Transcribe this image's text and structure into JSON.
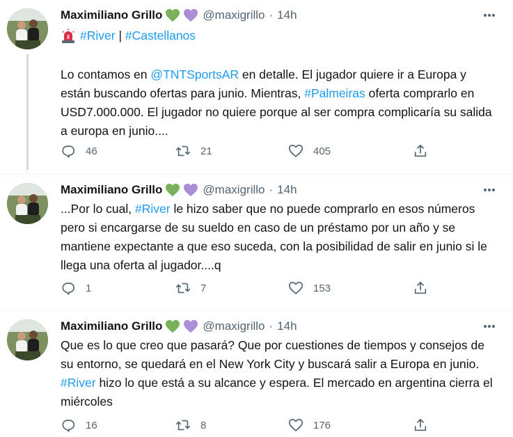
{
  "tweets": [
    {
      "name": "Maximiliano Grillo",
      "handle": "@maxigrillo",
      "time": "14h",
      "tags_prefix": "",
      "tag_river": "#River",
      "tag_sep": " | ",
      "tag_castellanos": "#Castellanos",
      "text_a": "Lo contamos en ",
      "mention": "@TNTSportsAR",
      "text_b": " en detalle. El jugador quiere ir a Europa y están buscando ofertas para junio. Mientras, ",
      "hashtag": "#Palmeiras",
      "text_c": " oferta comprarlo en USD7.000.000. El jugador no quiere porque al ser compra complicaría su salida a europa en junio....",
      "replies": "46",
      "retweets": "21",
      "likes": "405"
    },
    {
      "name": "Maximiliano Grillo",
      "handle": "@maxigrillo",
      "time": "14h",
      "text_a": "...Por lo cual, ",
      "hashtag": "#River",
      "text_b": " le hizo saber que no puede comprarlo en esos números pero si encargarse de su sueldo en caso de un préstamo por un año y se mantiene expectante a que eso suceda, con la posibilidad de salir en junio si le llega una oferta al jugador....q",
      "replies": "1",
      "retweets": "7",
      "likes": "153"
    },
    {
      "name": "Maximiliano Grillo",
      "handle": "@maxigrillo",
      "time": "14h",
      "text_a": "Que es lo que creo que pasará? Que por cuestiones de tiempos y consejos de su entorno, se quedará en el New York City y buscará salir a Europa en junio. ",
      "hashtag": "#River",
      "text_b": " hizo lo que está a su alcance y espera. El mercado en argentina cierra el miércoles",
      "replies": "16",
      "retweets": "8",
      "likes": "176"
    }
  ],
  "colors": {
    "link": "#1d9bf0",
    "secondary_text": "#536471",
    "green_heart": "#78b159",
    "purple_heart": "#aa8ed6",
    "divider": "#eff3f4"
  },
  "icons": [
    "reply-icon",
    "retweet-icon",
    "like-icon",
    "share-icon",
    "more-icon",
    "siren-icon",
    "green-heart-icon",
    "purple-heart-icon"
  ]
}
